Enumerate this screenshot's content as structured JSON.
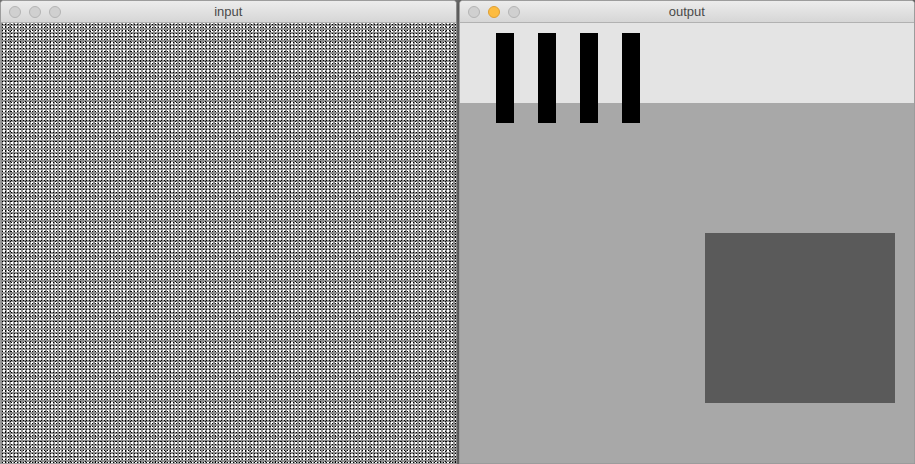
{
  "windows": [
    {
      "title": "input",
      "focused": false,
      "kind": "noisy",
      "buttons": [
        {
          "name": "close",
          "lit": false
        },
        {
          "name": "minimize",
          "lit": false
        },
        {
          "name": "zoom",
          "lit": false
        }
      ]
    },
    {
      "title": "output",
      "focused": true,
      "kind": "clean",
      "buttons": [
        {
          "name": "close",
          "lit": false
        },
        {
          "name": "minimize",
          "lit": true
        },
        {
          "name": "zoom",
          "lit": false
        }
      ]
    }
  ]
}
